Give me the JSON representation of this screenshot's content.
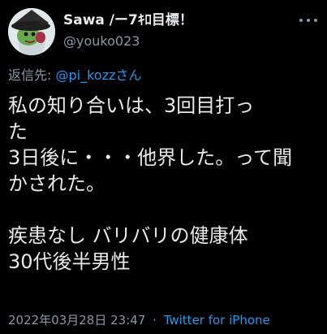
{
  "author": {
    "display_name": "Sawa /ー7ｷﾛ目標！",
    "handle": "@youko023"
  },
  "reply": {
    "prefix": "返信先:",
    "mention": "@pi_kozzさん"
  },
  "tweet": {
    "lines": [
      "私の知り合いは、3回目打っ",
      "た",
      "3日後に・・・他界した。って聞",
      "かされた。",
      "",
      "疾患なし バリバリの健康体",
      "30代後半男性"
    ]
  },
  "meta": {
    "timestamp": "2022年03月28日 23:47",
    "separator": "·",
    "source": "Twitter for iPhone"
  },
  "icons": {
    "more": "more-horizontal-icon",
    "avatar": "avatar-witch-hat-character"
  },
  "colors": {
    "background": "#000000",
    "primary_text": "#e7e9ea",
    "secondary_text": "#8b98a5",
    "link": "#1d9bf0"
  }
}
